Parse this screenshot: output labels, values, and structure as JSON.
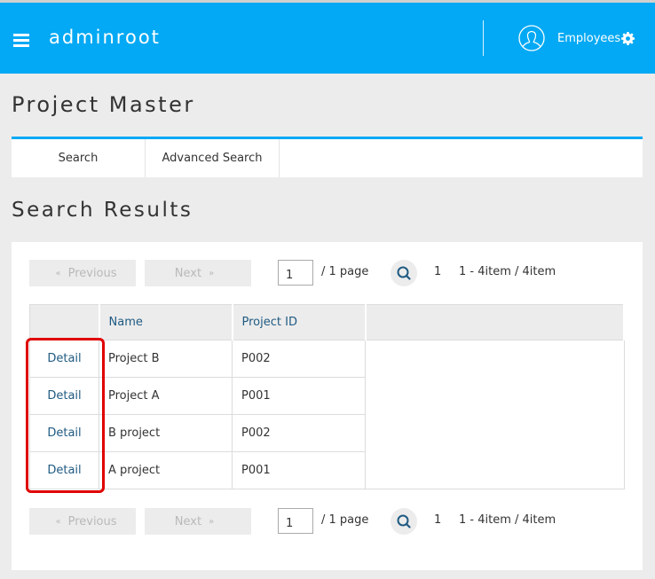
{
  "header": {
    "app_title": "adminroot",
    "user_label": "Employees",
    "brand_color": "#03a9f4"
  },
  "page": {
    "title": "Project Master",
    "tabs": [
      {
        "label": "Search"
      },
      {
        "label": "Advanced Search"
      }
    ]
  },
  "results": {
    "title": "Search Results",
    "pager": {
      "previous_label": "Previous",
      "previous_icon": "«",
      "next_label": "Next",
      "next_icon": "»",
      "page_value": "1",
      "page_suffix": "/  1 page",
      "current_page": "1",
      "range_text": "1 - 4item / 4item"
    },
    "columns": [
      "",
      "Name",
      "Project ID",
      ""
    ],
    "rows": [
      {
        "action": "Detail",
        "name": "Project B",
        "project_id": "P002"
      },
      {
        "action": "Detail",
        "name": "Project A",
        "project_id": "P001"
      },
      {
        "action": "Detail",
        "name": "B project",
        "project_id": "P002"
      },
      {
        "action": "Detail",
        "name": "A project",
        "project_id": "P001"
      }
    ]
  },
  "annotation": {
    "highlight_color": "#e00000"
  }
}
